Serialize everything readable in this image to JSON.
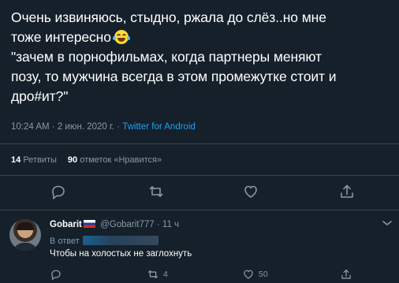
{
  "tweet": {
    "lines": [
      "Очень извиняюсь, стыдно, ржала до слёз..но мне",
      "тоже интересно",
      "\"зачем в порнофильмах, когда партнеры меняют",
      "позу, то мужчина всегда в этом промежутке стоит и",
      "дро#ит?\""
    ],
    "emoji": "face-with-tears-of-joy-icon",
    "time": "10:24 AM",
    "date": "2 июн. 2020 г.",
    "source": "Twitter for Android",
    "sep": " · "
  },
  "stats": {
    "retweets_count": "14",
    "retweets_label": "Ретвиты",
    "likes_count": "90",
    "likes_label": "отметок «Нравится»"
  },
  "reply": {
    "name": "Gobarit",
    "handle": "@Gobarit777",
    "time": "11 ч",
    "sep": " · ",
    "reply_to_label": "В ответ",
    "text": "Чтобы на холостых не заглохнуть",
    "retweet_count": "4",
    "like_count": "50"
  },
  "colors": {
    "background": "#15202b",
    "text": "#ffffff",
    "muted": "#8899a6",
    "accent": "#1da1f2",
    "divider": "#38444d"
  }
}
